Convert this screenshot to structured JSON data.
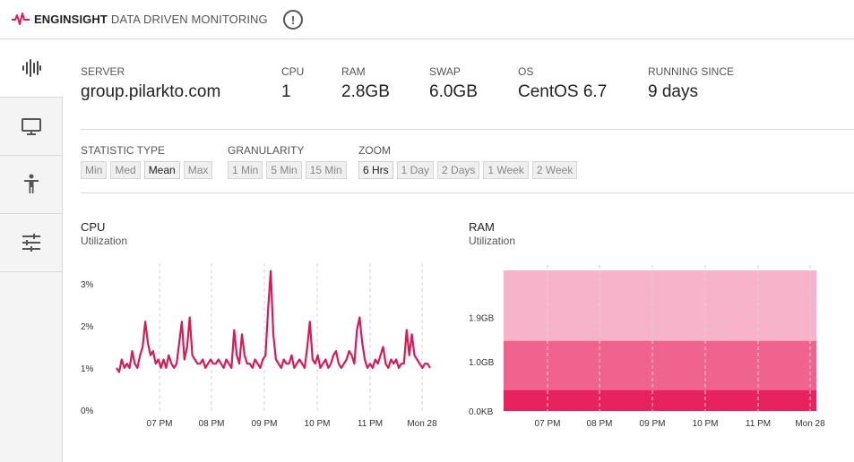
{
  "brand": {
    "name": "ENGINSIGHT",
    "tagline": "DATA DRIVEN MONITORING",
    "accent": "#e2185a"
  },
  "header": {
    "alert_icon": "exclamation-circle-icon",
    "alert_glyph": "!"
  },
  "sidebar": {
    "items": [
      {
        "name": "sidebar-item-monitoring",
        "icon": "pulse-bars-icon",
        "active": true
      },
      {
        "name": "sidebar-item-hosts",
        "icon": "monitor-icon",
        "active": false
      },
      {
        "name": "sidebar-item-accessibility",
        "icon": "person-icon",
        "active": false
      },
      {
        "name": "sidebar-item-settings",
        "icon": "sliders-icon",
        "active": false
      }
    ]
  },
  "server": {
    "server_label": "SERVER",
    "server_value": "group.pilarkto.com",
    "cpu_label": "CPU",
    "cpu_value": "1",
    "ram_label": "RAM",
    "ram_value": "2.8GB",
    "swap_label": "SWAP",
    "swap_value": "6.0GB",
    "os_label": "OS",
    "os_value": "CentOS 6.7",
    "running_label": "RUNNING SINCE",
    "running_value": "9 days"
  },
  "filters": {
    "statistic": {
      "label": "STATISTIC TYPE",
      "options": [
        "Min",
        "Med",
        "Mean",
        "Max"
      ],
      "selected": "Mean"
    },
    "granularity": {
      "label": "GRANULARITY",
      "options": [
        "1 Min",
        "5 Min",
        "15 Min"
      ],
      "selected": ""
    },
    "zoom": {
      "label": "ZOOM",
      "options": [
        "6 Hrs",
        "1 Day",
        "2 Days",
        "1 Week",
        "2 Week"
      ],
      "selected": "6 Hrs"
    }
  },
  "chart_data": [
    {
      "type": "line",
      "title": "CPU",
      "subtitle": "Utilization",
      "color": "#d91a55",
      "x_ticks": [
        "07 PM",
        "08 PM",
        "09 PM",
        "10 PM",
        "11 PM",
        "Mon 28"
      ],
      "y_ticks": [
        "0%",
        "1%",
        "2%",
        "3%"
      ],
      "ylim": [
        0,
        3.4
      ],
      "grid": "vertical-dashed",
      "series": [
        {
          "values": [
            1.0,
            0.9,
            1.2,
            1.0,
            1.1,
            1.0,
            1.4,
            1.1,
            1.0,
            1.3,
            1.5,
            2.1,
            1.6,
            1.3,
            1.4,
            1.1,
            1.2,
            1.0,
            1.2,
            1.0,
            1.3,
            1.1,
            1.0,
            1.1,
            1.6,
            2.1,
            1.2,
            1.5,
            2.2,
            1.3,
            1.2,
            1.1,
            1.1,
            1.2,
            1.0,
            1.1,
            1.2,
            1.1,
            1.1,
            1.2,
            1.1,
            1.0,
            1.2,
            1.1,
            1.0,
            1.9,
            1.3,
            1.1,
            1.8,
            1.3,
            1.1,
            1.1,
            1.0,
            1.2,
            1.1,
            1.0,
            1.2,
            1.3,
            2.4,
            3.3,
            1.8,
            1.2,
            1.1,
            1.0,
            1.2,
            1.1,
            1.1,
            1.3,
            1.0,
            1.1,
            1.2,
            1.1,
            1.0,
            1.5,
            2.1,
            1.2,
            1.1,
            1.3,
            1.0,
            1.1,
            1.2,
            1.0,
            1.1,
            1.3,
            1.4,
            1.1,
            1.0,
            1.1,
            1.2,
            1.4,
            1.3,
            1.1,
            1.9,
            2.2,
            1.6,
            1.2,
            1.0,
            1.1,
            1.0,
            1.2,
            1.1,
            1.3,
            1.5,
            1.1,
            1.0,
            1.2,
            1.1,
            1.2,
            1.0,
            1.1,
            1.1,
            1.9,
            1.3,
            1.8,
            1.3,
            1.2,
            1.1,
            1.0,
            1.1,
            1.1,
            1.0
          ]
        }
      ]
    },
    {
      "type": "area",
      "title": "RAM",
      "subtitle": "Utilization",
      "x_ticks": [
        "07 PM",
        "08 PM",
        "09 PM",
        "10 PM",
        "11 PM",
        "Mon 28"
      ],
      "y_ticks": [
        "0.0KB",
        "1.0GB",
        "1.9GB"
      ],
      "y_tick_values": [
        0,
        1.0,
        1.9
      ],
      "ylim": [
        0,
        2.85
      ],
      "grid": "vertical-dashed",
      "series": [
        {
          "name": "layer-1",
          "value": 0.42,
          "color": "#e8215f"
        },
        {
          "name": "layer-2",
          "value": 1.42,
          "color": "#f0638f"
        },
        {
          "name": "layer-3",
          "value": 2.85,
          "color": "#f6b3c9"
        }
      ]
    }
  ]
}
